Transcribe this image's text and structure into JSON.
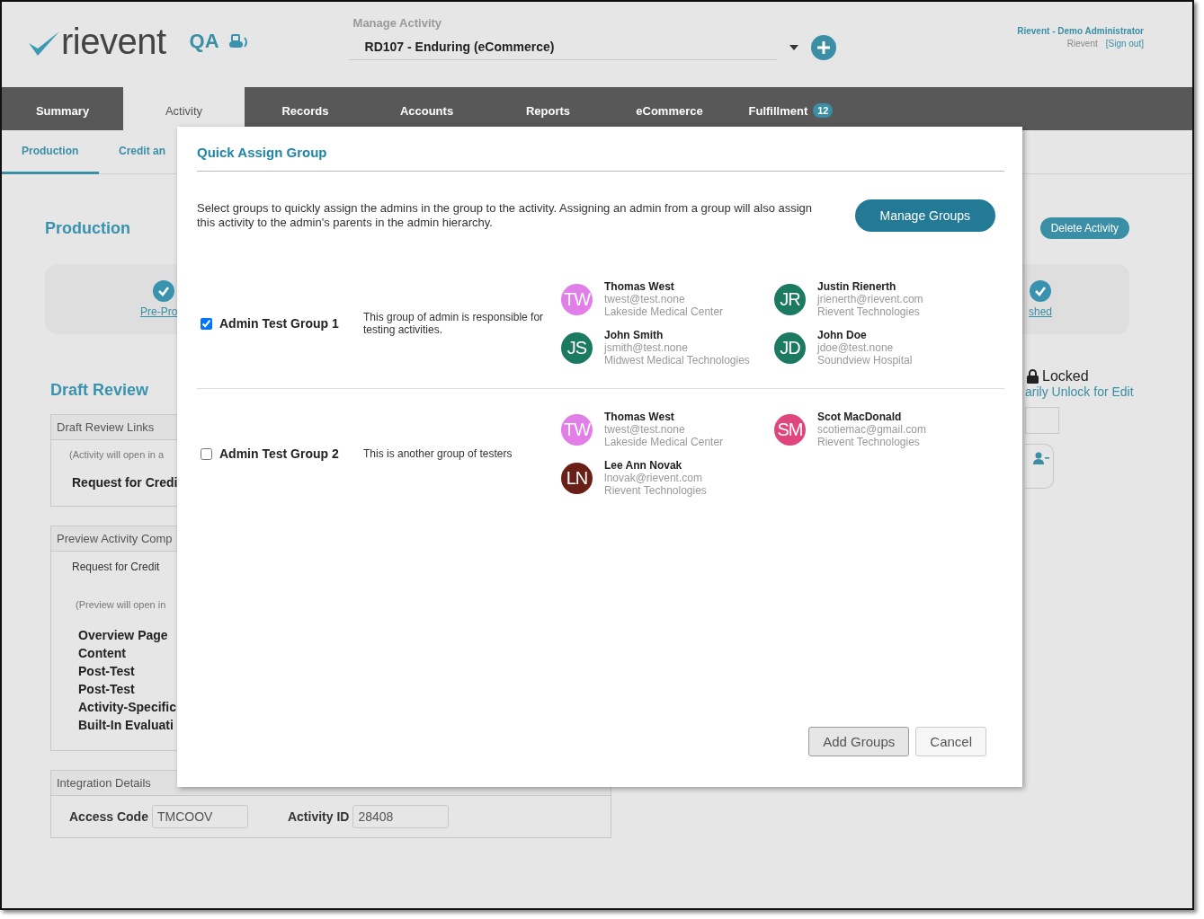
{
  "header": {
    "logo_text": "rievent",
    "env_label": "QA",
    "activity_selector": {
      "label": "Manage Activity",
      "value": "RD107 - Enduring (eCommerce)"
    },
    "user": {
      "name": "Rievent - Demo Administrator",
      "org": "Rievent",
      "sign_out": "[Sign out]"
    }
  },
  "nav_tabs": [
    {
      "label": "Summary",
      "selected": false
    },
    {
      "label": "Activity",
      "selected": true
    },
    {
      "label": "Records",
      "selected": false
    },
    {
      "label": "Accounts",
      "selected": false
    },
    {
      "label": "Reports",
      "selected": false
    },
    {
      "label": "eCommerce",
      "selected": false
    },
    {
      "label": "Fulfillment",
      "selected": false,
      "badge": "12"
    }
  ],
  "sub_tabs": [
    {
      "label": "Production",
      "selected": true
    },
    {
      "label": "Credit an",
      "selected": false
    }
  ],
  "page": {
    "title": "Production",
    "delete_button": "Delete Activity",
    "steps": [
      {
        "label": "Pre-Pro"
      },
      {
        "label": "shed"
      }
    ],
    "draft_review": {
      "title": "Draft Review",
      "panel_title": "Draft Review Links",
      "note": "(Activity will open in a",
      "link": "Request for Credi"
    },
    "preview_panel": {
      "title": "Preview Activity Comp",
      "subtitle": "Request for Credit",
      "note": "(Preview will open in",
      "items": [
        "Overview Page",
        "Content",
        "Post-Test",
        "Post-Test",
        "Activity-Specific",
        "Built-In Evaluati"
      ]
    },
    "integration": {
      "title": "Integration Details",
      "fields": [
        {
          "label": "Access Code",
          "value": "TMCOOV"
        },
        {
          "label": "Activity ID",
          "value": "28408"
        }
      ]
    },
    "lock": {
      "status": "Locked",
      "unlock_link": "arily Unlock for Edit"
    }
  },
  "modal": {
    "title": "Quick Assign Group",
    "description": "Select groups to quickly assign the admins in the group to the activity. Assigning an admin from a group will also assign this activity to the admin's parents in the admin hierarchy.",
    "manage_button": "Manage Groups",
    "groups": [
      {
        "name": "Admin Test Group 1",
        "checked": true,
        "description": "This group of admin is responsible for testing activities.",
        "members": [
          {
            "initials": "TW",
            "color": "#e27ee8",
            "name": "Thomas West",
            "email": "twest@test.none",
            "org": "Lakeside Medical Center"
          },
          {
            "initials": "JR",
            "color": "#1d7a62",
            "name": "Justin Rienerth",
            "email": "jrienerth@rievent.com",
            "org": "Rievent Technologies"
          },
          {
            "initials": "JS",
            "color": "#1d7a62",
            "name": "John Smith",
            "email": "jsmith@test.none",
            "org": "Midwest Medical Technologies"
          },
          {
            "initials": "JD",
            "color": "#1d7a62",
            "name": "John Doe",
            "email": "jdoe@test.none",
            "org": "Soundview Hospital"
          }
        ]
      },
      {
        "name": "Admin Test Group 2",
        "checked": false,
        "description": "This is another group of testers",
        "members": [
          {
            "initials": "TW",
            "color": "#e27ee8",
            "name": "Thomas West",
            "email": "twest@test.none",
            "org": "Lakeside Medical Center"
          },
          {
            "initials": "SM",
            "color": "#e0457b",
            "name": "Scot MacDonald",
            "email": "scotiemac@gmail.com",
            "org": "Rievent Technologies"
          },
          {
            "initials": "LN",
            "color": "#6a1f16",
            "name": "Lee Ann Novak",
            "email": "lnovak@rievent.com",
            "org": "Rievent Technologies"
          }
        ]
      }
    ],
    "buttons": [
      {
        "label": "Add Groups",
        "kind": "primary"
      },
      {
        "label": "Cancel",
        "kind": "secondary"
      }
    ]
  }
}
